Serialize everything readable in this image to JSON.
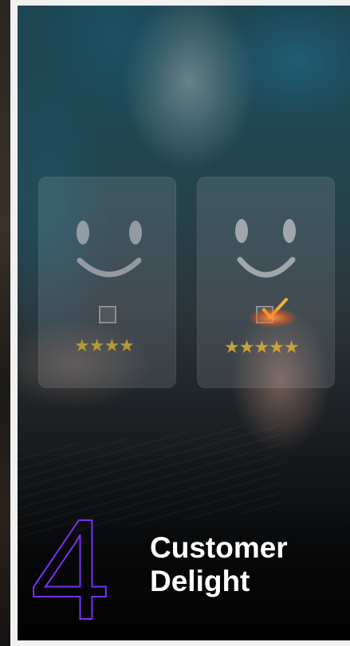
{
  "feature": {
    "number": "4",
    "title_line1": "Customer",
    "title_line2": "Delight"
  },
  "ratings": {
    "left_panel": {
      "stars": "★★★★",
      "star_color": "#b59a35"
    },
    "right_panel": {
      "stars": "★★★★★",
      "star_color": "#c9a23a"
    }
  },
  "colors": {
    "number_outline": "#7b2ff7",
    "title": "#ffffff",
    "check": "#f2b233"
  }
}
